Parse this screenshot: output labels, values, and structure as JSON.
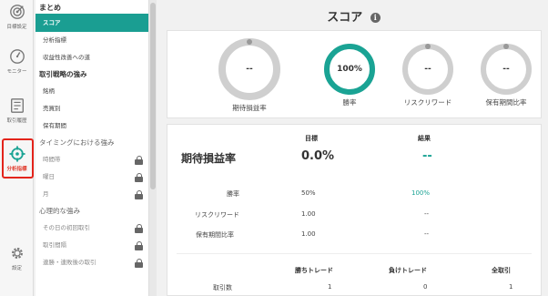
{
  "rail": {
    "items": [
      {
        "label": "目標設定",
        "icon": "target-icon"
      },
      {
        "label": "モニター",
        "icon": "gauge-icon"
      },
      {
        "label": "取引履歴",
        "icon": "history-icon"
      },
      {
        "label": "分析指標",
        "icon": "analysis-icon"
      },
      {
        "label": "設定",
        "icon": "gear-icon"
      }
    ],
    "active_color": "#e03a2b"
  },
  "submenu": {
    "heading": "まとめ",
    "items_top": [
      {
        "label": "スコア"
      },
      {
        "label": "分析指標"
      },
      {
        "label": "収益性改善への道"
      }
    ],
    "section_trade": "取引戦略の強み",
    "items_trade": [
      {
        "label": "銘柄"
      },
      {
        "label": "売買別"
      },
      {
        "label": "保有期間"
      }
    ],
    "section_timing": "タイミングにおける強み",
    "items_timing": [
      {
        "label": "時間帯"
      },
      {
        "label": "曜日"
      },
      {
        "label": "月"
      }
    ],
    "section_psych": "心理的な強み",
    "items_psych": [
      {
        "label": "その日の初回取引"
      },
      {
        "label": "取引間隔"
      },
      {
        "label": "連勝・連敗後の取引"
      }
    ],
    "accent": "#1a9e92"
  },
  "main": {
    "title": "スコア",
    "info_glyph": "i",
    "gauges": [
      {
        "value": "--",
        "caption": "期待損益率",
        "progress": 0
      },
      {
        "value": "100%",
        "caption": "勝率",
        "progress": 100
      },
      {
        "value": "--",
        "caption": "リスクリワード",
        "progress": 0
      },
      {
        "value": "--",
        "caption": "保有期間比率",
        "progress": 0
      }
    ],
    "table": {
      "col_target": "目標",
      "col_result": "結果",
      "metric_label": "期待損益率",
      "metric_target": "0.0%",
      "metric_result": "--",
      "rows": [
        {
          "label": "勝率",
          "target": "50%",
          "result": "100%"
        },
        {
          "label": "リスクリワード",
          "target": "1.00",
          "result": "--"
        },
        {
          "label": "保有期間比率",
          "target": "1.00",
          "result": "--"
        }
      ],
      "trade_cols": [
        "勝ちトレード",
        "負けトレード",
        "全取引"
      ],
      "trade_row": {
        "label": "取引数",
        "values": [
          "1",
          "0",
          "1"
        ]
      }
    }
  }
}
